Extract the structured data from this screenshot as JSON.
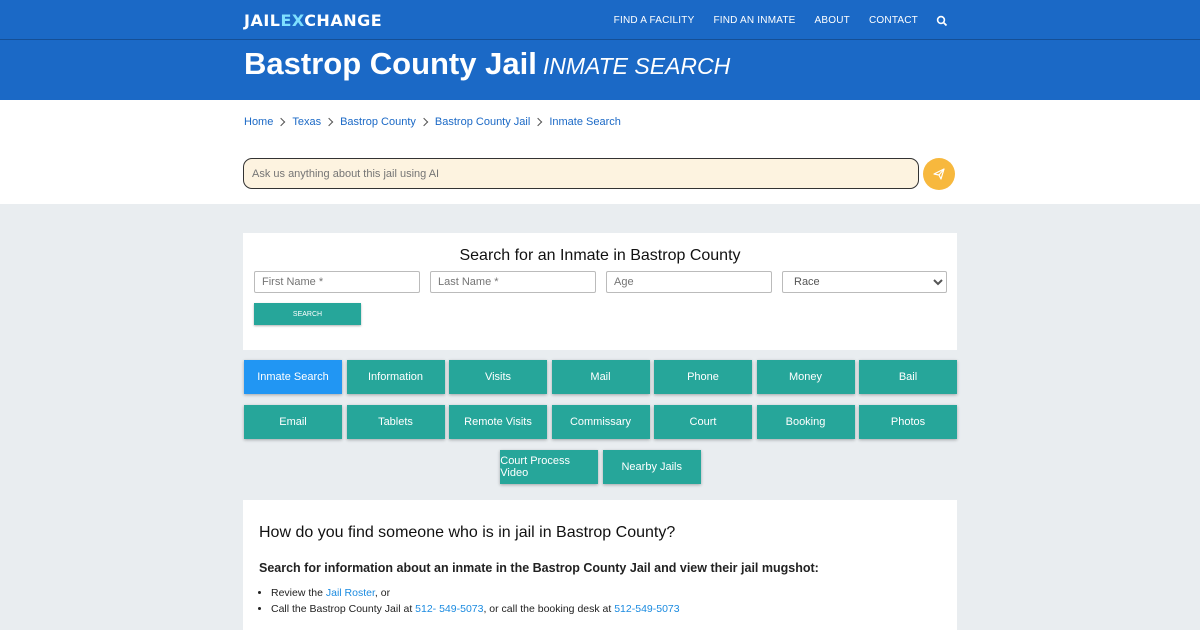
{
  "logo": {
    "part1": "JAIL",
    "part2": "E",
    "part3": "X",
    "part4": "CHANGE"
  },
  "nav": {
    "items": [
      "FIND A FACILITY",
      "FIND AN INMATE",
      "ABOUT",
      "CONTACT"
    ]
  },
  "hero": {
    "title": "Bastrop County Jail",
    "subtitle": "INMATE SEARCH"
  },
  "breadcrumb": [
    "Home",
    "Texas",
    "Bastrop County",
    "Bastrop County Jail",
    "Inmate Search"
  ],
  "ai": {
    "placeholder": "Ask us anything about this jail using AI"
  },
  "search_card": {
    "title": "Search for an Inmate in Bastrop County",
    "first_name_placeholder": "First Name *",
    "last_name_placeholder": "Last Name *",
    "age_placeholder": "Age",
    "race_selected": "Race",
    "search_label": "Search"
  },
  "buttons": {
    "row1": [
      "Inmate Search",
      "Information",
      "Visits",
      "Mail",
      "Phone",
      "Money",
      "Bail"
    ],
    "row2": [
      "Email",
      "Tablets",
      "Remote Visits",
      "Commissary",
      "Court",
      "Booking",
      "Photos"
    ],
    "row3": [
      "Court Process Video",
      "Nearby Jails"
    ]
  },
  "content": {
    "heading": "How do you find someone who is in jail in Bastrop County?",
    "subheading": "Search for information about an inmate in the Bastrop County Jail and view their jail mugshot:",
    "li1_pre": "Review the ",
    "li1_link": "Jail Roster",
    "li1_post": ", or",
    "li2_pre": "Call the Bastrop County Jail at ",
    "li2_link1": "512- 549-5073",
    "li2_mid": ", or call the booking desk at ",
    "li2_link2": "512-549-5073"
  },
  "colors": {
    "primary": "#1b69c6",
    "teal": "#26a69a",
    "active": "#2196f3",
    "send": "#f7b83d"
  }
}
